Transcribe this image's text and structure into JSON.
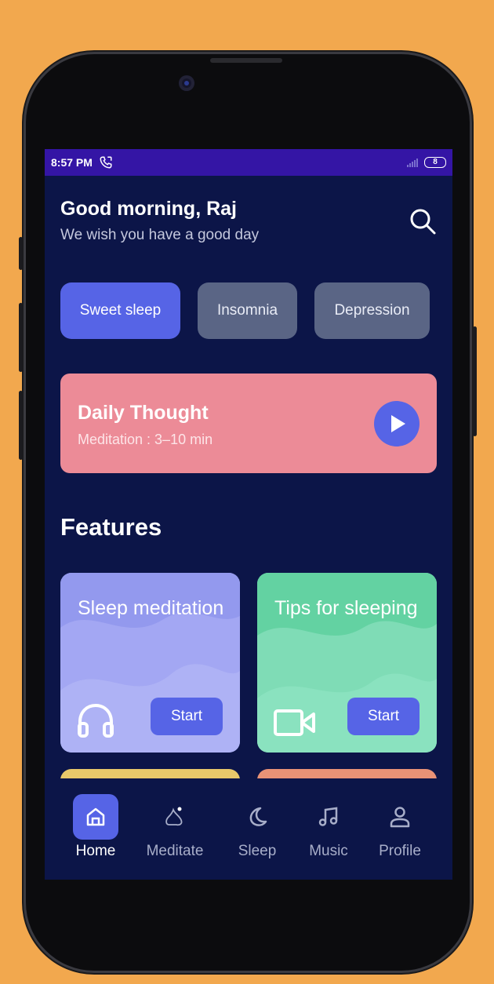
{
  "status_bar": {
    "time": "8:57 PM",
    "battery": "8"
  },
  "header": {
    "greeting": "Good morning, Raj",
    "subtitle": "We wish you have a good day"
  },
  "chips": [
    {
      "label": "Sweet sleep",
      "active": true
    },
    {
      "label": "Insomnia",
      "active": false
    },
    {
      "label": "Depression",
      "active": false
    }
  ],
  "daily": {
    "title": "Daily Thought",
    "meta": "Meditation : 3–10 min"
  },
  "features": {
    "title": "Features",
    "cards": [
      {
        "title": "Sleep meditation",
        "button": "Start",
        "icon": "headphones-icon",
        "color": "#a3a7f3"
      },
      {
        "title": "Tips for sleeping",
        "button": "Start",
        "icon": "video-camera-icon",
        "color": "#7fdcb6"
      }
    ]
  },
  "nav": [
    {
      "label": "Home",
      "icon": "home-icon",
      "active": true
    },
    {
      "label": "Meditate",
      "icon": "meditate-icon",
      "active": false
    },
    {
      "label": "Sleep",
      "icon": "moon-icon",
      "active": false
    },
    {
      "label": "Music",
      "icon": "music-note-icon",
      "active": false
    },
    {
      "label": "Profile",
      "icon": "person-icon",
      "active": false
    }
  ],
  "colors": {
    "accent": "#5664e6",
    "background": "#0c1548",
    "daily_card": "#ec8b97",
    "outer": "#f2a84e"
  }
}
